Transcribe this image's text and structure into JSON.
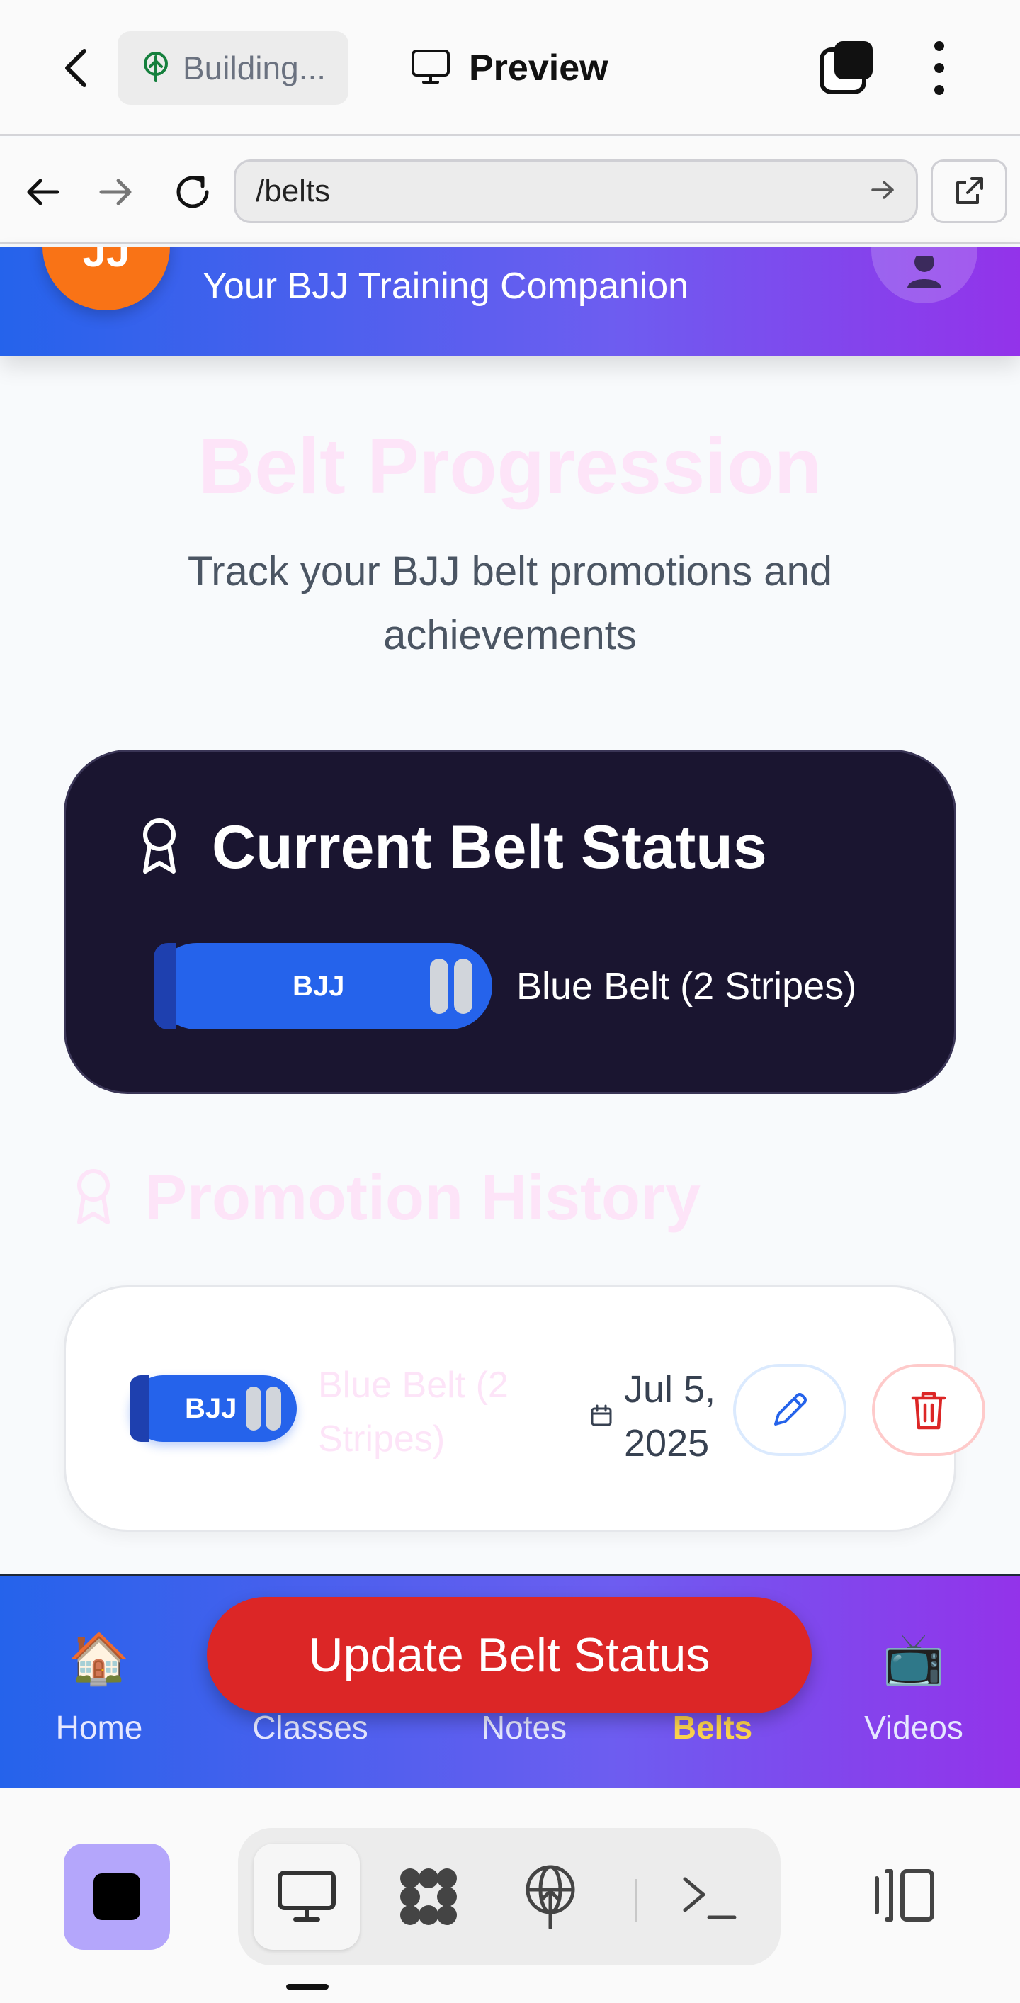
{
  "topbar": {
    "building_label": "Building...",
    "preview_label": "Preview"
  },
  "urlbar": {
    "url": "/belts"
  },
  "app_header": {
    "logo_text": "JJ",
    "tagline": "Your BJJ Training Companion"
  },
  "page": {
    "title": "Belt Progression",
    "subtitle": "Track your BJJ belt promotions and achievements"
  },
  "current_belt": {
    "heading": "Current Belt Status",
    "belt_text": "BJJ",
    "status": "Blue Belt (2 Stripes)",
    "color": "#2563eb",
    "stripes": 2
  },
  "history": {
    "heading": "Promotion History",
    "entries": [
      {
        "belt_text": "BJJ",
        "name": "Blue Belt (2 Stripes)",
        "date": "Jul 5, 2025",
        "stripes": 2
      }
    ]
  },
  "bottom_nav": {
    "items": [
      {
        "label": "Home",
        "icon": "house-icon",
        "emoji": "🏠"
      },
      {
        "label": "Classes",
        "icon": "classes-icon",
        "emoji": ""
      },
      {
        "label": "Notes",
        "icon": "notes-icon",
        "emoji": ""
      },
      {
        "label": "Belts",
        "icon": "belt-icon",
        "emoji": "",
        "active": true
      },
      {
        "label": "Videos",
        "icon": "tv-icon",
        "emoji": "📺"
      }
    ],
    "update_button": "Update Belt Status"
  },
  "colors": {
    "header_gradient": [
      "#2563eb",
      "#9333ea"
    ],
    "card_bg": "#1a1530",
    "update_button": "#dc2626",
    "active_nav": "#fcd34d"
  }
}
